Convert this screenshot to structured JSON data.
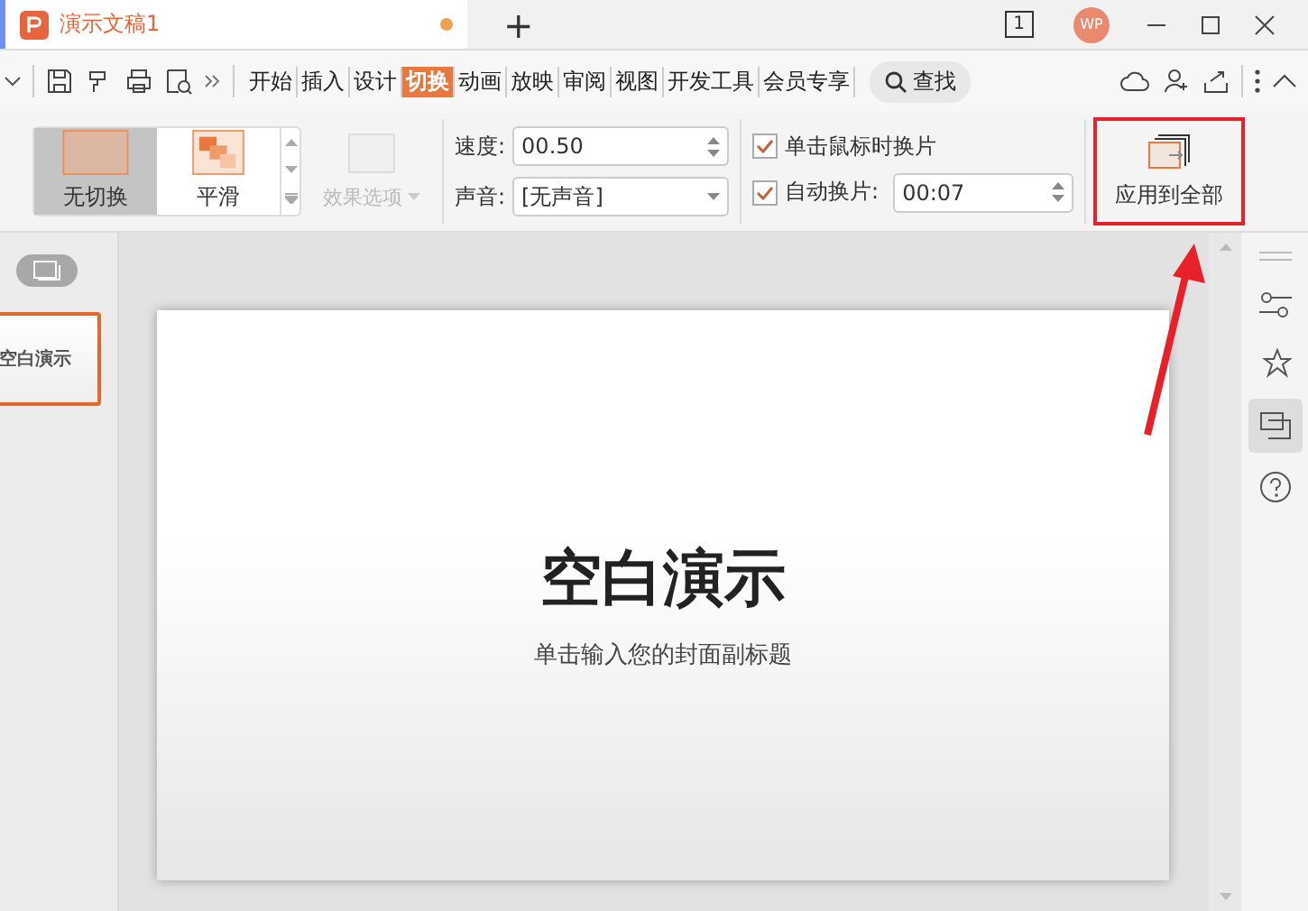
{
  "document_tab": {
    "title": "演示文稿1",
    "unsaved": true
  },
  "new_tab": "+",
  "page_counter": "1",
  "avatar": "WP",
  "menu_tabs": [
    {
      "label": "开始",
      "selected": false
    },
    {
      "label": "插入",
      "selected": false
    },
    {
      "label": "设计",
      "selected": false
    },
    {
      "label": "切换",
      "selected": true
    },
    {
      "label": "动画",
      "selected": false
    },
    {
      "label": "放映",
      "selected": false
    },
    {
      "label": "审阅",
      "selected": false
    },
    {
      "label": "视图",
      "selected": false
    },
    {
      "label": "开发工具",
      "selected": false
    },
    {
      "label": "会员专享",
      "selected": false
    }
  ],
  "search": {
    "label": "查找"
  },
  "transitions": [
    {
      "label": "无切换",
      "selected": true
    },
    {
      "label": "平滑",
      "selected": false
    }
  ],
  "effect_options": {
    "label": "效果选项",
    "disabled": true
  },
  "speed": {
    "label": "速度:",
    "value": "00.50"
  },
  "sound": {
    "label": "声音:",
    "value": "[无声音]"
  },
  "on_click": {
    "label": "单击鼠标时换片",
    "checked": true
  },
  "auto_advance": {
    "label": "自动换片:",
    "checked": true,
    "value": "00:07"
  },
  "apply_all": {
    "label": "应用到全部"
  },
  "thumbnail": {
    "title": "空白演示",
    "selected": true
  },
  "slide": {
    "title": "空白演示",
    "subtitle": "单击输入您的封面副标题"
  }
}
